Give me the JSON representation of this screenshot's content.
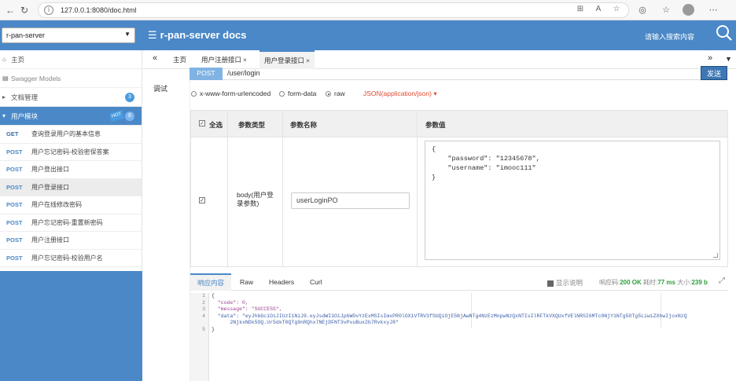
{
  "browser": {
    "url": "127.0.0.1:8080/doc.html"
  },
  "header": {
    "group_select": "r-pan-server",
    "title": "r-pan-server docs",
    "search_placeholder": "请输入搜索内容"
  },
  "sidebar": {
    "home": "主页",
    "swagger_models": "Swagger Models",
    "doc_manage": "文档管理",
    "doc_manage_count": "3",
    "user_module": "用户模块",
    "user_module_count": "8",
    "hot_label": "HOT",
    "apis": [
      {
        "method": "GET",
        "label": "查询登录用户的基本信息"
      },
      {
        "method": "POST",
        "label": "用户忘记密码-校验密保答案"
      },
      {
        "method": "POST",
        "label": "用户登出接口"
      },
      {
        "method": "POST",
        "label": "用户登录接口"
      },
      {
        "method": "POST",
        "label": "用户在线修改密码"
      },
      {
        "method": "POST",
        "label": "用户忘记密码-重置新密码"
      },
      {
        "method": "POST",
        "label": "用户注册接口"
      },
      {
        "method": "POST",
        "label": "用户忘记密码-校验用户名"
      }
    ]
  },
  "tabs": {
    "items": [
      {
        "label": "主页"
      },
      {
        "label": "用户注册接口"
      },
      {
        "label": "用户登录接口"
      }
    ],
    "close": "×"
  },
  "debug": {
    "subtab": "调试",
    "method": "POST",
    "url": "/user/login",
    "send": "发送",
    "body_types": [
      "x-www-form-urlencoded",
      "form-data",
      "raw"
    ],
    "body_format": "JSON(application/json)",
    "table": {
      "headers": [
        "全选",
        "参数类型",
        "参数名称",
        "参数值"
      ],
      "row": {
        "type": "body(用户登录参数)",
        "name": "userLoginPO"
      }
    },
    "json_lines": [
      "{",
      "    \"password\": \"12345678\",",
      "    \"username\": \"imooc111\"",
      "}"
    ]
  },
  "response": {
    "tabs": [
      "响应内容",
      "Raw",
      "Headers",
      "Curl"
    ],
    "show_desc": "显示说明",
    "status_label": "响应码:",
    "status_code": "200 OK",
    "time_label": "耗时:",
    "time_value": "77 ms",
    "size_label": "大小:",
    "size_value": "239 b",
    "line_numbers": [
      "1",
      "2",
      "3",
      "4",
      "",
      "5"
    ],
    "code_lines": [
      "{",
      "  \"code\": 0,",
      "  \"message\": \"SUCCESS\",",
      "  \"data\": \"eyJhbGciOiJIUzI1NiJ9.eyJsdWI1OiJpbWOvYzExMSIsImxPR0lOX1VTRV3fSUQiOjE5NjAwNTg4NzEzMnpwNzQxNTIsIlRFTkVXQUxfVElNRSI6MTc0NjY1NTg5OTg5LiwiZXhwIjoxNzQ",
      "      2NjkxNDk5OQ.Ur5dkT0QTg9nRQhx7NEjDFNT3vPvuBux2b7RvkxyJ8\"",
      "}"
    ]
  },
  "colors": {
    "brand": "#4a88c7",
    "post_method_bg": "#80b3e3",
    "send_button": "#3d78b5",
    "json_format": "#e0492f",
    "status_ok": "#2e9d3a"
  },
  "icons": [
    "back-arrow-icon",
    "refresh-icon",
    "info-icon",
    "menu-icon",
    "search-icon",
    "home-icon",
    "folder-icon",
    "checkbox-icon",
    "expand-icon"
  ]
}
